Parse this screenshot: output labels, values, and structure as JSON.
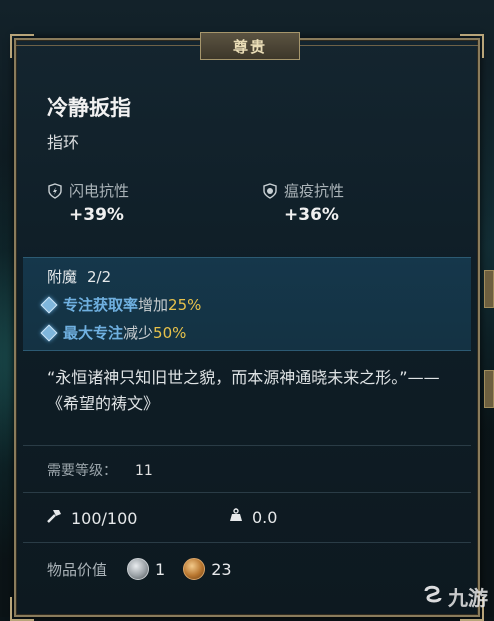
{
  "tooltip": {
    "rarity": "尊贵",
    "name": "冷静扳指",
    "type": "指环",
    "stats": [
      {
        "icon": "lightning-shield-icon",
        "label": "闪电抗性",
        "value": "+39%"
      },
      {
        "icon": "plague-shield-icon",
        "label": "瘟疫抗性",
        "value": "+36%"
      }
    ],
    "enchant": {
      "label": "附魔",
      "count": "2/2",
      "rows": [
        {
          "highlight": "专注获取率",
          "verb": "增加",
          "amount": "25%"
        },
        {
          "highlight": "最大专注",
          "verb": "减少",
          "amount": "50%"
        }
      ]
    },
    "flavor": "“永恒诸神只知旧世之貌，而本源神通晓未来之形。”——《希望的祷文》",
    "requirement": {
      "label": "需要等级：",
      "value": "11"
    },
    "durability": "100/100",
    "weight": "0.0",
    "item_value": {
      "label": "物品价值",
      "silver": "1",
      "gold": "23"
    }
  },
  "watermark": {
    "text": "九游"
  },
  "colors": {
    "accent": "#6fb0e0",
    "number": "#e7c24b",
    "border": "#8a7c5c"
  }
}
